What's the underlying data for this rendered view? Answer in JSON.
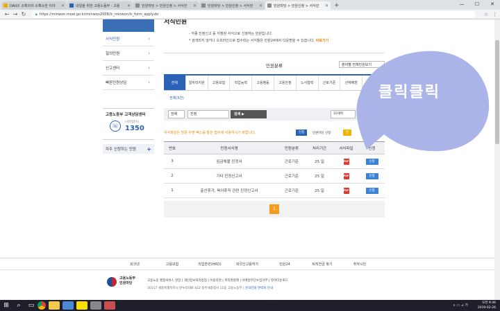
{
  "browser": {
    "tabs": [
      {
        "title": "DAILY: 소확이의 소확소한 이야",
        "color": "#f0ad00",
        "active": false
      },
      {
        "title": "내일을 위한 고용노동부 - 고용",
        "color": "#2a62b8",
        "active": false
      },
      {
        "title": "민원마당 > 민원신청 > 서식민",
        "color": "#8a8a8a",
        "active": false
      },
      {
        "title": "민원마당 > 민원신청 > 서식민",
        "color": "#8a8a8a",
        "active": false
      },
      {
        "title": "민원마당 > 민원신청 > 서식민",
        "color": "#8a8a8a",
        "active": true
      }
    ],
    "new_tab": "+",
    "url": "https://minwon.moel.go.kr/minwon2008/lc_minwon/lc_form_apply.do",
    "win": {
      "min": "—",
      "max": "☐",
      "close": "✕"
    }
  },
  "sidebar": {
    "items": [
      {
        "label": "서식민원",
        "active": true
      },
      {
        "label": "질의민원",
        "active": false
      },
      {
        "label": "신고센터",
        "active": false
      },
      {
        "label": "빠른민원상담",
        "active": false
      }
    ],
    "callcenter": {
      "title": "고용노동부 고객상담센터",
      "sub": "(국번없이)",
      "number": "1350"
    },
    "frequent": "자주 신청하는 민원"
  },
  "main": {
    "section_title": "서식민원",
    "notes": [
      "- 각종 진정신고 등 지정된 서식으로 신청하는 민원입니다.",
      "* 검색되지 않거나 오프라인으로 접수되는 서식들은 민원24에서 다운받을 수 있습니다."
    ],
    "notes_link": "바로가기",
    "category_title": "민원분류",
    "sort_select": "분야별 전체민원보기",
    "tabs": [
      "전체",
      "일자리지원",
      "고용보험",
      "직업능력",
      "고용평등",
      "고용안정",
      "노사협력",
      "근로기준",
      "산재예방",
      "외국인"
    ],
    "subtab": "전체(3건)",
    "search": {
      "select": "전체",
      "keyword": "진정",
      "button": "검색",
      "count": "10개씩"
    },
    "warning": "서식파일은 방문 우편 팩스를 통한 접수에 사용하시기 바랍니다.",
    "badge_apply": "신청",
    "badge_apply_text": "민원마당 신청",
    "badge_orange": "민",
    "table": {
      "headers": [
        "번호",
        "민원서식명",
        "민원분류",
        "처리기간",
        "서식파일",
        "신청"
      ],
      "rows": [
        {
          "no": "3",
          "name": "임금체불 진정서",
          "category": "근로기준",
          "period": "25 일",
          "file": "PDF",
          "apply": "신청"
        },
        {
          "no": "2",
          "name": "기타 진정신고서",
          "category": "근로기준",
          "period": "25 일",
          "file": "PDF",
          "apply": "신청"
        },
        {
          "no": "1",
          "name": "출산휴가, 육아휴직 관련 진정신고서",
          "category": "근로기준",
          "period": "25 일",
          "file": "PDF",
          "apply": "신청"
        }
      ]
    },
    "page": "1"
  },
  "footer": {
    "links": [
      "워크넷",
      "고용보험",
      "직업훈련(HRD)",
      "외국인고용허가",
      "민원24",
      "퇴직연금 찾기",
      "취약시민"
    ],
    "logo_text": [
      "고용노동부",
      "민원마당"
    ],
    "line1": "고용노동 행정서비스 현장  |  개인정보처리방침  |  이용약관  |  저작권정책  |  이메일무단수집거부  |  뷰어다운로드",
    "line2": "30117 세종특별자치시 한누리대로 422 정부세종청사 11동 고용노동부",
    "contact": "문의전화 연락처 안내"
  },
  "overlay": {
    "text": "클릭클릭",
    "color": "#aab4e8"
  },
  "taskbar": {
    "time": "오전 9:46",
    "date": "2019-02-26",
    "tray": "∧ ▭ ⊿ 가"
  }
}
